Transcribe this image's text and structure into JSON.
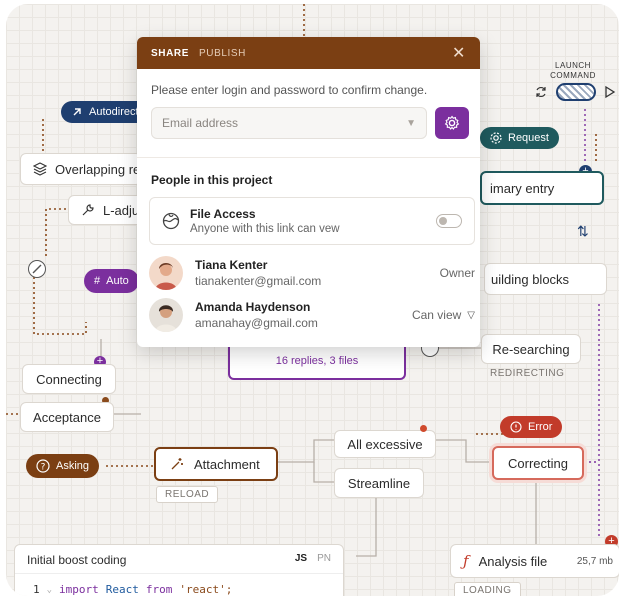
{
  "modal": {
    "tabs": [
      "SHARE",
      "PUBLISH"
    ],
    "prompt": "Please enter login and password to confirm change.",
    "email_placeholder": "Email address",
    "people_title": "People in this project",
    "file_access": {
      "title": "File Access",
      "subtitle": "Anyone with this link can vew"
    },
    "people": [
      {
        "name": "Tiana Kenter",
        "email": "tianakenter@gmail.com",
        "role": "Owner"
      },
      {
        "name": "Amanda Haydenson",
        "email": "amanahay@gmail.com",
        "role": "Can view"
      }
    ]
  },
  "canvas": {
    "autodirect": "Autodirect",
    "overlapping": "Overlapping re",
    "l_adjust": "L-adju",
    "auto": "Auto",
    "connecting": "Connecting",
    "acceptance": "Acceptance",
    "asking": "Asking",
    "attachment": "Attachment",
    "reload": "RELOAD",
    "replies": "16 replies, 3 files",
    "all_excessive": "All excessive",
    "streamline": "Streamline",
    "error": "Error",
    "correcting": "Correcting",
    "re_searching": "Re-searching",
    "redirecting": "REDIRECTING",
    "building_blocks": "uilding blocks",
    "primary_entry": "imary entry",
    "request": "Request",
    "launch_command": "LAUNCH COMMAND",
    "analysis_file": "Analysis file",
    "analysis_size": "25,7 mb",
    "loading": "LOADING",
    "code_panel": {
      "title": "Initial boost coding",
      "tabs": [
        "JS",
        "PN"
      ],
      "line_no": "1",
      "kw_import": "import",
      "ident": "React",
      "kw_from": "from",
      "str": "'react';"
    }
  },
  "colors": {
    "brown": "#7b3f13",
    "purple": "#7b2f9e",
    "navy": "#1f3f70",
    "teal": "#1f5a5e",
    "red": "#c23b2a",
    "dot_brown": "#8a4a1c"
  },
  "icons": [
    "close-icon",
    "chevron-down-icon",
    "gear-icon",
    "globe-icon",
    "arrow-icon",
    "layers-icon",
    "wrench-icon",
    "question-icon",
    "sparkle-icon",
    "refresh-icon",
    "play-icon",
    "sort-icon",
    "script-icon",
    "info-icon",
    "plus-icon",
    "hash-icon",
    "slash-circle-icon"
  ]
}
